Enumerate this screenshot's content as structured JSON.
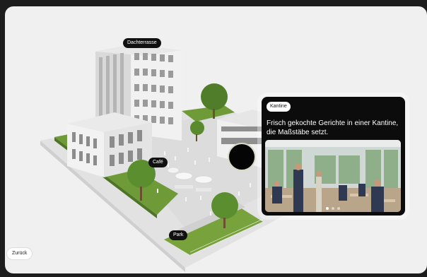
{
  "labels": {
    "rooftop": "Dachterrasse",
    "cafe": "Café",
    "park": "Park"
  },
  "info_card": {
    "badge": "Kantine",
    "text": "Frisch gekochte Gerichte in einer Kantine, die Maßstäbe setzt.",
    "slides_total": 3,
    "slide_active": 1
  },
  "nav": {
    "back_label": "Zurück"
  },
  "colors": {
    "frame_bg": "#f0f0f0",
    "outer_bg": "#1d1d1d",
    "pill_bg": "#111111",
    "lawn": "#6e9a38",
    "building": "#ececec"
  }
}
